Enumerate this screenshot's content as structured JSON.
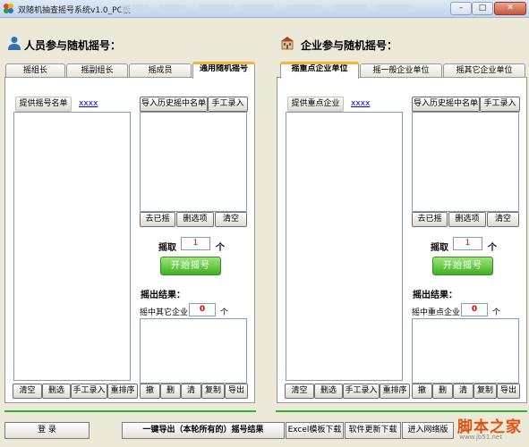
{
  "window": {
    "title": "双随机抽查摇号系统v1.0_PC板",
    "minimize": "–",
    "maximize": "□",
    "close": "✕"
  },
  "left": {
    "section_title": "人员参与随机摇号：",
    "tabs": [
      "摇组长",
      "摇副组长",
      "摇成员",
      "通用随机摇号"
    ],
    "list_header": "提供摇号名单",
    "list_link": "xxxx",
    "import_btn": "导入历史摇中名单",
    "manual_btn": "手工录入",
    "remove_btn": "去已摇",
    "delete_sel_btn": "删选项",
    "clear_btn": "清空",
    "draw_label": "摇取",
    "draw_count": "1",
    "unit": "个",
    "start_btn": "开始摇号",
    "result_label": "摇出结果：",
    "hit_label": "摇中其它企业",
    "hit_count": "0",
    "bottom_btns": [
      "清空",
      "删选",
      "手工录入",
      "重排序"
    ],
    "result_btns": [
      "撤",
      "删",
      "清",
      "复制",
      "导出"
    ]
  },
  "right": {
    "section_title": "企业参与随机摇号：",
    "tabs": [
      "摇重点企业单位",
      "摇一般企业单位",
      "摇其它企业单位"
    ],
    "list_header": "提供重点企业",
    "list_link": "xxxx",
    "import_btn": "导入历史摇中名单",
    "manual_btn": "手工录入",
    "remove_btn": "去已摇",
    "delete_sel_btn": "删选项",
    "clear_btn": "清空",
    "draw_label": "摇取",
    "draw_count": "1",
    "unit": "个",
    "start_btn": "开始摇号",
    "result_label": "摇出结果：",
    "hit_label": "摇中重点企业",
    "hit_count": "0",
    "bottom_btns": [
      "清空",
      "删选",
      "手工录入",
      "重排序"
    ],
    "result_btns": [
      "撤",
      "删",
      "清",
      "复制",
      "导出"
    ]
  },
  "footer": {
    "login_btn": "登 录",
    "export_btn": "一键导出（本轮所有的）摇号结果",
    "excel_btn": "Excel模板下载",
    "update_btn": "软件更新下载",
    "network_btn": "进入网络版",
    "watermark": "脚本之家",
    "watermark_url": "www.jb51.net"
  }
}
